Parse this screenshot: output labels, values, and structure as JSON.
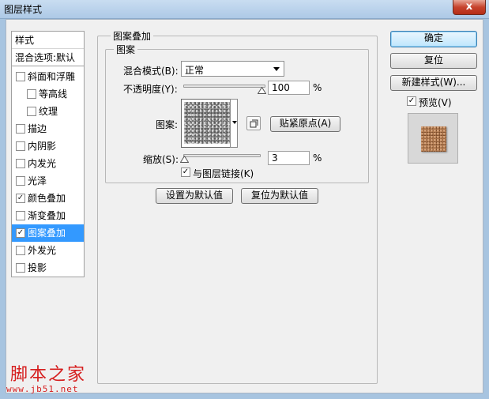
{
  "window": {
    "title": "图层样式",
    "close_glyph": "x"
  },
  "left_panel": {
    "items": [
      {
        "label": "样式",
        "type": "header"
      },
      {
        "label": "混合选项:默认",
        "type": "header"
      },
      {
        "label": "斜面和浮雕",
        "checked": false,
        "type": "item"
      },
      {
        "label": "等高线",
        "checked": false,
        "type": "sub"
      },
      {
        "label": "纹理",
        "checked": false,
        "type": "sub"
      },
      {
        "label": "描边",
        "checked": false,
        "type": "item"
      },
      {
        "label": "内阴影",
        "checked": false,
        "type": "item"
      },
      {
        "label": "内发光",
        "checked": false,
        "type": "item"
      },
      {
        "label": "光泽",
        "checked": false,
        "type": "item"
      },
      {
        "label": "颜色叠加",
        "checked": true,
        "type": "item"
      },
      {
        "label": "渐变叠加",
        "checked": false,
        "type": "item"
      },
      {
        "label": "图案叠加",
        "checked": true,
        "type": "item",
        "selected": true
      },
      {
        "label": "外发光",
        "checked": false,
        "type": "item"
      },
      {
        "label": "投影",
        "checked": false,
        "type": "item"
      }
    ]
  },
  "main": {
    "group_title": "图案叠加",
    "subgroup_title": "图案",
    "blend_mode": {
      "label": "混合模式(B):",
      "value": "正常"
    },
    "opacity": {
      "label": "不透明度(Y):",
      "value": "100",
      "unit": "%",
      "level": 1.0
    },
    "pattern": {
      "label": "图案:",
      "snap_button": "贴紧原点(A)"
    },
    "scale": {
      "label": "缩放(S):",
      "value": "3",
      "unit": "%",
      "level": 0.0
    },
    "link": {
      "label": "与图层链接(K)",
      "checked": true
    },
    "set_default_button": "设置为默认值",
    "reset_default_button": "复位为默认值"
  },
  "right_panel": {
    "ok_button": "确定",
    "reset_button": "复位",
    "new_style_button": "新建样式(W)...",
    "preview": {
      "label": "预览(V)",
      "checked": true
    }
  },
  "watermark": {
    "text": "脚本之家",
    "url": "www.jb51.net"
  },
  "colors": {
    "selected_bg": "#3399ff",
    "watermark": "#d61f1f",
    "preview_texture": "#b27a4e"
  }
}
